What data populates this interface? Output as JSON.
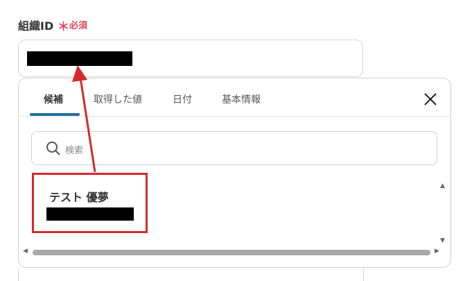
{
  "field": {
    "label": "組織ID",
    "required_mark": "＊",
    "required_text": "必須"
  },
  "tabs": [
    {
      "label": "候補"
    },
    {
      "label": "取得した値"
    },
    {
      "label": "日付"
    },
    {
      "label": "基本情報"
    }
  ],
  "search": {
    "placeholder": "検索"
  },
  "results": [
    {
      "name": "テスト 優夢"
    }
  ],
  "colors": {
    "required": "#e0455d",
    "tab_underline": "#1f6fa0",
    "highlight": "#d42a2a"
  },
  "icons": {
    "close": "close-icon",
    "search": "search-icon"
  }
}
